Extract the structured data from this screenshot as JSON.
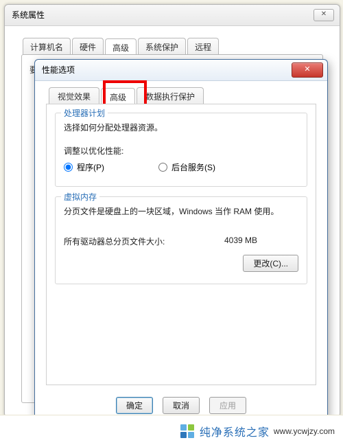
{
  "sysprops": {
    "title": "系统属性",
    "tabs": [
      "计算机名",
      "硬件",
      "高级",
      "系统保护",
      "远程"
    ],
    "active_tab_index": 2,
    "hint": "要进行大多数更改，你必须作为管理员登录。"
  },
  "perf": {
    "title": "性能选项",
    "tabs": [
      "视觉效果",
      "高级",
      "数据执行保护"
    ],
    "active_tab_index": 1,
    "close_label": "✕",
    "group_cpu": {
      "legend": "处理器计划",
      "desc": "选择如何分配处理器资源。",
      "optimize_label": "调整以优化性能:",
      "radio_programs_label": "程序(P)",
      "radio_background_label": "后台服务(S)",
      "selected": "programs"
    },
    "group_vm": {
      "legend": "虚拟内存",
      "desc1": "分页文件是硬盘上的一块区域，Windows 当作 RAM 使用。",
      "total_label": "所有驱动器总分页文件大小:",
      "total_value": "4039 MB",
      "change_label": "更改(C)..."
    },
    "buttons": {
      "ok": "确定",
      "cancel": "取消",
      "apply": "应用"
    }
  },
  "sysprops_close": "✕",
  "watermark": {
    "brand": "纯净系统之家",
    "url": "www.ycwjzy.com"
  }
}
